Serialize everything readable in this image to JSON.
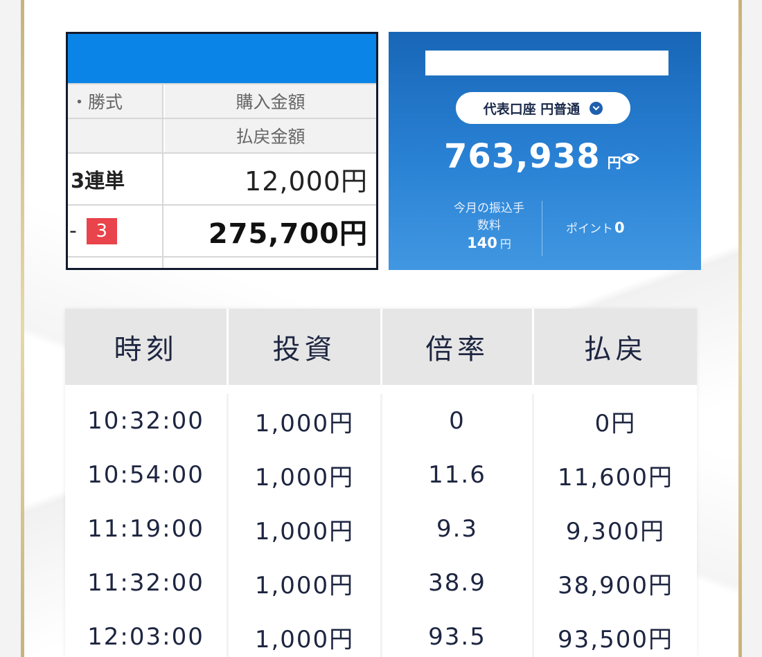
{
  "ticket": {
    "header_col_left": "・勝式",
    "header_col_right": "購入金額",
    "header2_col_right": "払戻金額",
    "bet_type": "3連単",
    "purchase_amount": "12,000円",
    "combo_prefix": "-",
    "combo_badge": "3",
    "payout_amount": "275,700円"
  },
  "bank": {
    "account_label": "代表口座 円普通",
    "balance": "763,938",
    "balance_unit": "円",
    "fee_label_line1": "今月の振込手",
    "fee_label_line2": "数料",
    "fee_value": "140",
    "fee_unit": "円",
    "points_label": "ポイント",
    "points_value": "0",
    "colors": {
      "card_top": "#1866b7",
      "card_bottom": "#4197e0"
    }
  },
  "results": {
    "columns": [
      "時刻",
      "投資",
      "倍率",
      "払戻"
    ],
    "rows": [
      [
        "10:32:00",
        "1,000円",
        "0",
        "0円"
      ],
      [
        "10:54:00",
        "1,000円",
        "11.6",
        "11,600円"
      ],
      [
        "11:19:00",
        "1,000円",
        "9.3",
        "9,300円"
      ],
      [
        "11:32:00",
        "1,000円",
        "38.9",
        "38,900円"
      ],
      [
        "12:03:00",
        "1,000円",
        "93.5",
        "93,500円"
      ]
    ]
  }
}
